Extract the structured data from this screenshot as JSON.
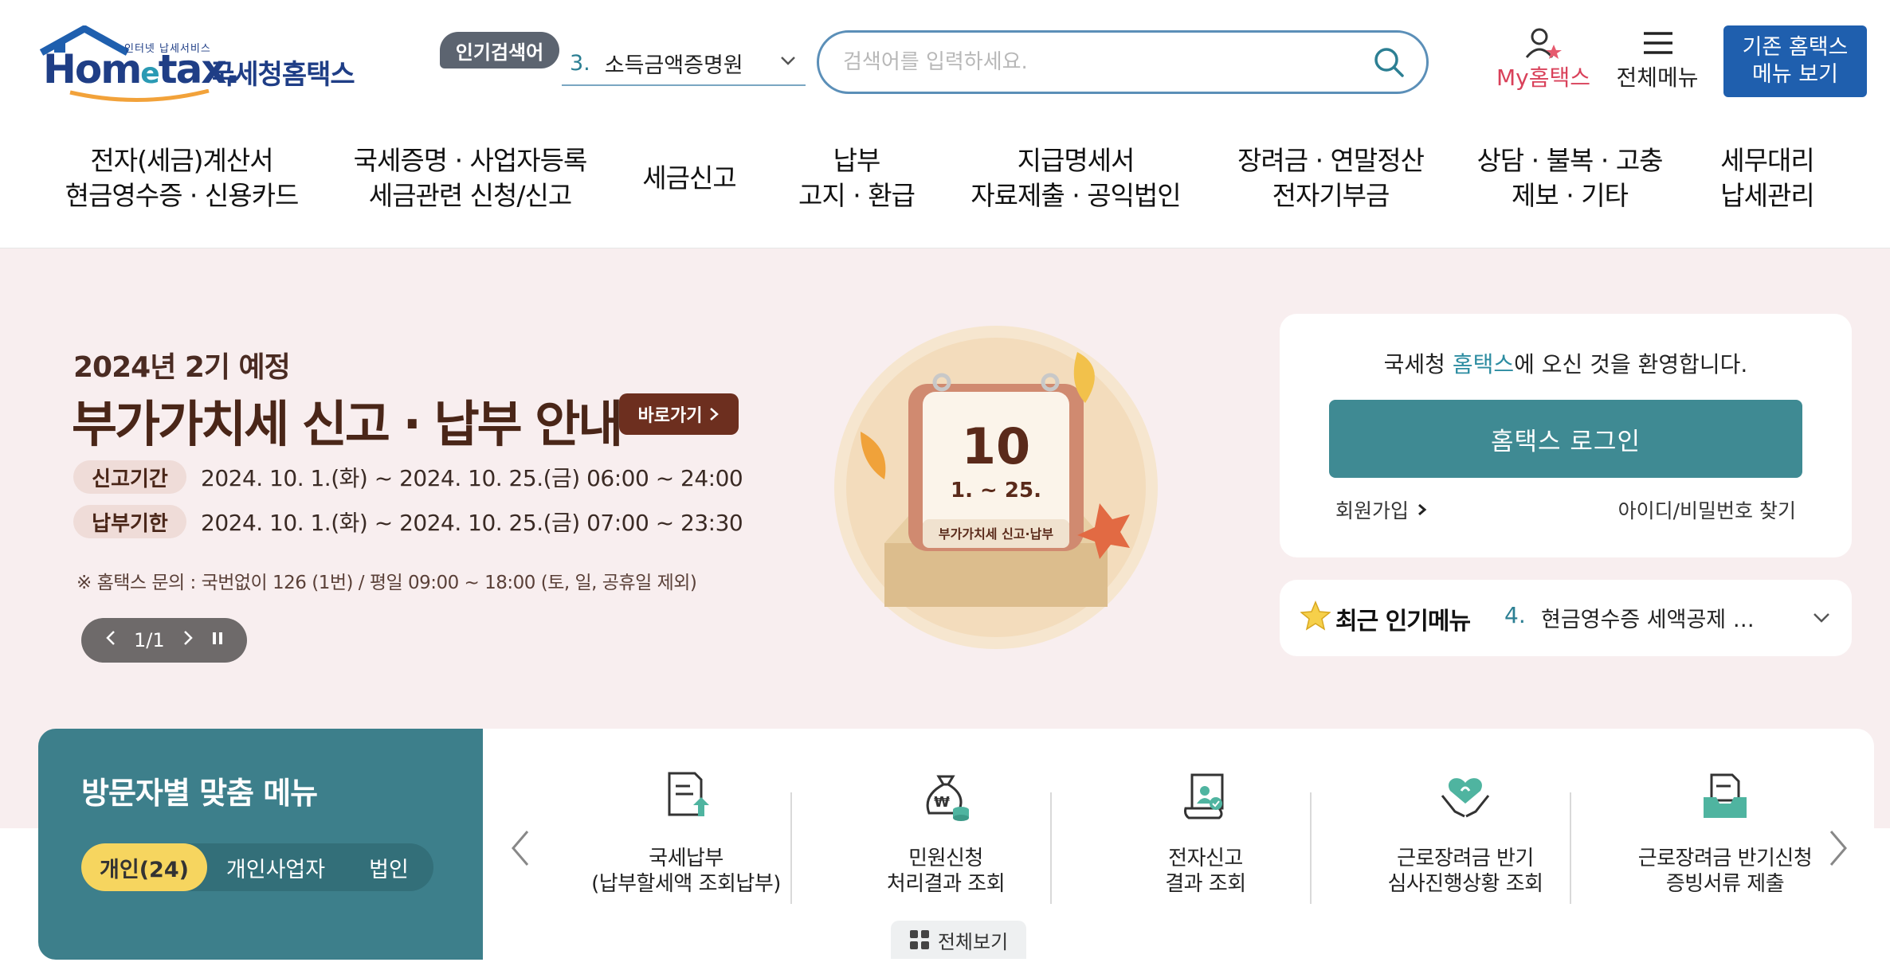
{
  "header": {
    "logo_small": "인터넷 납세서비스",
    "logo_word_1": "Hom",
    "logo_word_e": "e",
    "logo_word_2": "tax.",
    "logo_kr": "국세청홈택스",
    "popular_badge": "인기검색어",
    "popular_rank": "3.",
    "popular_keyword": "소득금액증명원",
    "search_placeholder": "검색어를 입력하세요.",
    "my_hometax": "My홈택스",
    "all_menu": "전체메뉴",
    "old_menu_line1": "기존 홈택스",
    "old_menu_line2": "메뉴 보기"
  },
  "gnb": [
    {
      "l1": "전자(세금)계산서",
      "l2": "현금영수증 · 신용카드"
    },
    {
      "l1": "국세증명 · 사업자등록",
      "l2": "세금관련 신청/신고"
    },
    {
      "l1": "세금신고",
      "l2": ""
    },
    {
      "l1": "납부",
      "l2": "고지 · 환급"
    },
    {
      "l1": "지급명세서",
      "l2": "자료제출 · 공익법인"
    },
    {
      "l1": "장려금 · 연말정산",
      "l2": "전자기부금"
    },
    {
      "l1": "상담 · 불복 · 고충",
      "l2": "제보 · 기타"
    },
    {
      "l1": "세무대리",
      "l2": "납세관리"
    }
  ],
  "banner": {
    "subtitle": "2024년 2기 예정",
    "title": "부가가치세 신고 · 납부 안내",
    "go_button": "바로가기",
    "rows": [
      {
        "tag": "신고기간",
        "date": "2024. 10. 1.(화) ~ 2024. 10. 25.(금)  06:00 ~ 24:00"
      },
      {
        "tag": "납부기한",
        "date": "2024. 10. 1.(화) ~ 2024. 10. 25.(금)  07:00 ~ 23:30"
      }
    ],
    "note": "※ 홈택스 문의 : 국번없이 126 (1번) / 평일 09:00 ~ 18:00 (토, 일, 공휴일 제외)",
    "page_indicator": "1/1",
    "calendar_day": "10",
    "calendar_range": "1. ~ 25.",
    "calendar_label": "부가가치세 신고·납부",
    "colors": {
      "bg": "#f8eeef",
      "title": "#4a2618",
      "button": "#6d2f1f"
    }
  },
  "login": {
    "welcome_pre": "국세청 ",
    "welcome_hl": "홈택스",
    "welcome_post": "에 오신 것을 환영합니다.",
    "login_button": "홈택스 로그인",
    "join": "회원가입",
    "find": "아이디/비밀번호 찾기",
    "accent": "#3f8a93"
  },
  "popular_menu": {
    "title": "최근 인기메뉴",
    "rank": "4.",
    "item": "현금영수증 세액공제 …"
  },
  "visitor": {
    "title": "방문자별 맞춤 메뉴",
    "tabs": [
      "개인(24)",
      "개인사업자",
      "법인"
    ],
    "active_tab": 0
  },
  "quick_menu": {
    "items": [
      {
        "icon": "tax-payment-icon",
        "l1": "국세납부",
        "l2": "(납부할세액 조회납부)"
      },
      {
        "icon": "money-bag-icon",
        "l1": "민원신청",
        "l2": "처리결과 조회"
      },
      {
        "icon": "e-filing-icon",
        "l1": "전자신고",
        "l2": "결과 조회"
      },
      {
        "icon": "heart-hands-icon",
        "l1": "근로장려금 반기",
        "l2": "심사진행상황 조회"
      },
      {
        "icon": "document-tray-icon",
        "l1": "근로장려금 반기신청",
        "l2": "증빙서류 제출"
      }
    ],
    "all_view": "전체보기"
  }
}
